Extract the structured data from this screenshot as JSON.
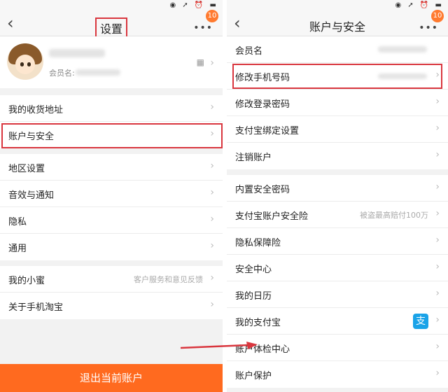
{
  "status": {
    "icons": "◉ ➚ ⏰ ▬"
  },
  "left": {
    "title": "设置",
    "badge": "10",
    "profile": {
      "member_label": "会员名:",
      "qr_icon": "qr-code-icon"
    },
    "items_a": [
      {
        "label": "我的收货地址"
      },
      {
        "label": "账户与安全"
      }
    ],
    "items_b": [
      {
        "label": "地区设置"
      },
      {
        "label": "音效与通知"
      },
      {
        "label": "隐私"
      },
      {
        "label": "通用"
      }
    ],
    "items_c": [
      {
        "label": "我的小蜜",
        "sub": "客户服务和意见反馈"
      },
      {
        "label": "关于手机淘宝"
      }
    ],
    "logout": "退出当前账户"
  },
  "right": {
    "title": "账户与安全",
    "badge": "10",
    "group1": [
      {
        "label": "会员名"
      },
      {
        "label": "修改手机号码"
      },
      {
        "label": "修改登录密码"
      },
      {
        "label": "支付宝绑定设置"
      },
      {
        "label": "注销账户"
      }
    ],
    "group2": [
      {
        "label": "内置安全密码"
      },
      {
        "label": "支付宝账户安全险",
        "sub": "被盗最高赔付100万"
      },
      {
        "label": "隐私保障险"
      },
      {
        "label": "安全中心"
      },
      {
        "label": "我的日历"
      },
      {
        "label": "我的支付宝",
        "icon_text": "支"
      },
      {
        "label": "账户体检中心"
      },
      {
        "label": "账户保护"
      }
    ]
  },
  "colors": {
    "accent": "#ff6a1f",
    "highlight": "#d9363e"
  }
}
